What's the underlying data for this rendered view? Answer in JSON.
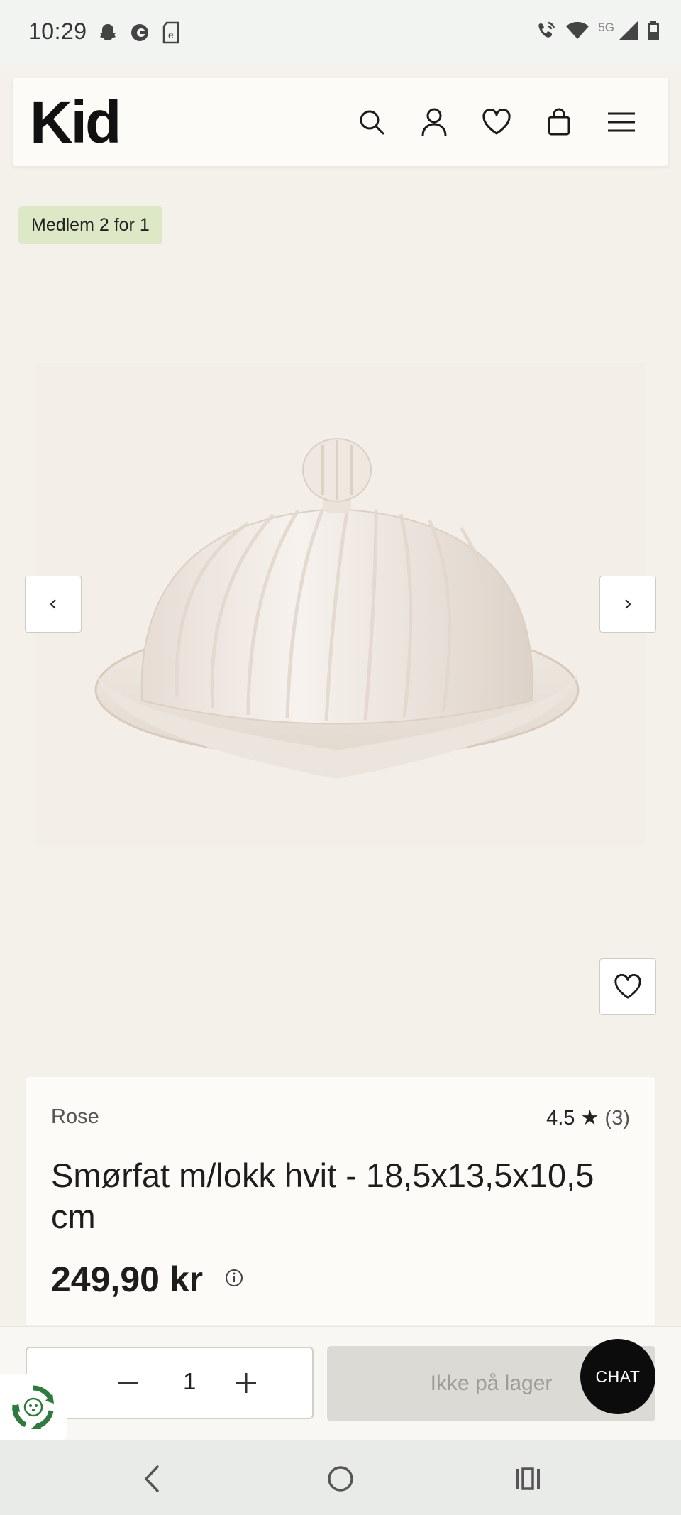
{
  "status_bar": {
    "time": "10:29",
    "network": "5G",
    "left_icons": [
      "snapchat-icon",
      "sync-icon",
      "document-icon"
    ],
    "right_icons": [
      "wifi-call-icon",
      "wifi-icon",
      "signal-icon",
      "battery-icon"
    ]
  },
  "header": {
    "logo": "Kid",
    "icons": [
      "search-icon",
      "account-icon",
      "heart-icon",
      "bag-icon",
      "menu-icon"
    ]
  },
  "product": {
    "badge": "Medlem 2 for 1",
    "image_alt": "Smørfat m/lokk hvit",
    "brand": "Rose",
    "rating": "4.5 ★",
    "rating_count": "(3)",
    "title": "Smørfat m/lokk hvit - 18,5x13,5x10,5 cm",
    "price": "249,90 kr"
  },
  "purchase": {
    "quantity": "1",
    "stock_button": "Ikke på lager",
    "chat_button": "CHAT"
  },
  "colors": {
    "background": "#f4f1ea",
    "badge": "#dce8c6",
    "card": "#fcfbf7",
    "disabled_button": "#dcdad5",
    "chat": "#0c0c0c"
  }
}
